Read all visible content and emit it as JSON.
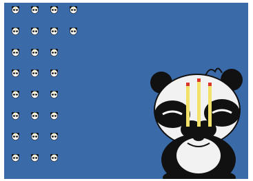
{
  "desktop": {
    "background_color": "#3a6aa8",
    "icon_name": "panda-incense-icon",
    "icons": [
      {
        "label": ""
      },
      {
        "label": ""
      },
      {
        "label": ""
      },
      {
        "label": ""
      },
      {
        "label": ""
      },
      {
        "label": ""
      },
      {
        "label": ""
      },
      {
        "label": ""
      },
      {
        "label": ""
      },
      {
        "label": ""
      },
      {
        "label": ""
      },
      {
        "label": ""
      },
      {
        "label": ""
      },
      {
        "label": ""
      },
      {
        "label": ""
      },
      {
        "label": ""
      },
      {
        "label": ""
      },
      {
        "label": ""
      },
      {
        "label": ""
      },
      {
        "label": ""
      },
      {
        "label": ""
      },
      {
        "label": ""
      },
      {
        "label": ""
      },
      {
        "label": ""
      },
      {
        "label": ""
      },
      {
        "label": ""
      },
      {
        "label": ""
      },
      {
        "label": ""
      },
      {
        "label": ""
      },
      {
        "label": ""
      },
      {
        "label": ""
      },
      {
        "label": ""
      }
    ]
  },
  "wallpaper": {
    "subject": "panda-holding-incense"
  }
}
